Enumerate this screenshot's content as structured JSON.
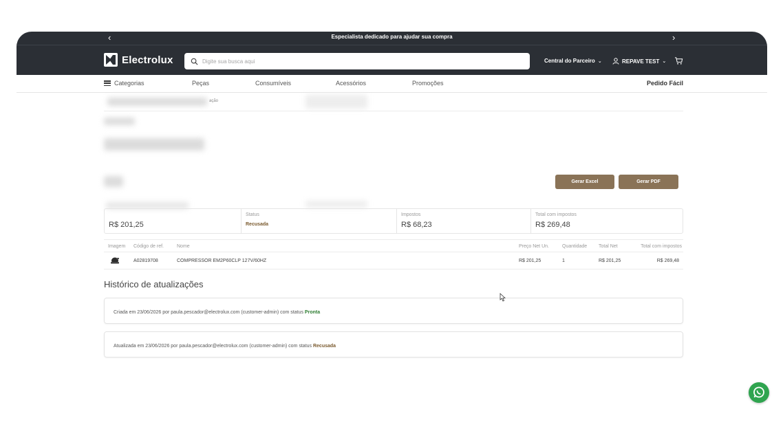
{
  "promo": {
    "text": "Especialista dedicado para ajudar sua compra",
    "prev_symbol": "‹",
    "next_symbol": "›"
  },
  "header": {
    "brand": "Electrolux",
    "search_placeholder": "Digite sua busca aqui",
    "partner_label": "Central do Parceiro",
    "user_label": "REPAVE TEST",
    "chevron": "⌄"
  },
  "nav": {
    "categories": "Categorias",
    "items": [
      "Peças",
      "Consumíveis",
      "Acessórios",
      "Promoções"
    ],
    "quick_order": "Pedido Fácil"
  },
  "breadcrumb": {
    "visible_fragment": "ação"
  },
  "actions": {
    "excel": "Gerar Excel",
    "pdf": "Gerar PDF"
  },
  "summary": {
    "subtotal_value": "R$ 201,25",
    "status_label": "Status",
    "status_value": "Recusada",
    "taxes_label": "Impostos",
    "taxes_value": "R$ 68,23",
    "total_label": "Total com impostos",
    "total_value": "R$ 269,48"
  },
  "table": {
    "headers": [
      "Imagem",
      "Código de ref.",
      "Nome",
      "Preço Net Un.",
      "Quantidade",
      "Total Net",
      "Total com impostos"
    ],
    "rows": [
      {
        "code": "A02819708",
        "name": "COMPRESSOR EM2P60CLP 127V/60HZ",
        "unit_price": "R$ 201,25",
        "qty": "1",
        "total_net": "R$ 201,25",
        "total_tax": "R$ 269,48"
      }
    ]
  },
  "history": {
    "title": "Histórico de atualizações",
    "entries": [
      {
        "text": "Criada em 23/06/2026 por paula.pescador@electrolux.com (customer-admin) com status",
        "status": "Pronta"
      },
      {
        "text": "Atualizada em 23/06/2026 por paula.pescador@electrolux.com (customer-admin) com status",
        "status": "Recusada"
      }
    ]
  },
  "colors": {
    "header_bg": "#2b2f35",
    "button_bg": "#8a7357",
    "status_refused": "#7a5a2e",
    "status_ready": "#2e7d32",
    "whatsapp": "#2fa44f"
  },
  "icons": [
    "electrolux-logo-icon",
    "search-icon",
    "user-icon",
    "cart-icon",
    "menu-icon",
    "compressor-image",
    "cursor-icon",
    "whatsapp-icon"
  ]
}
